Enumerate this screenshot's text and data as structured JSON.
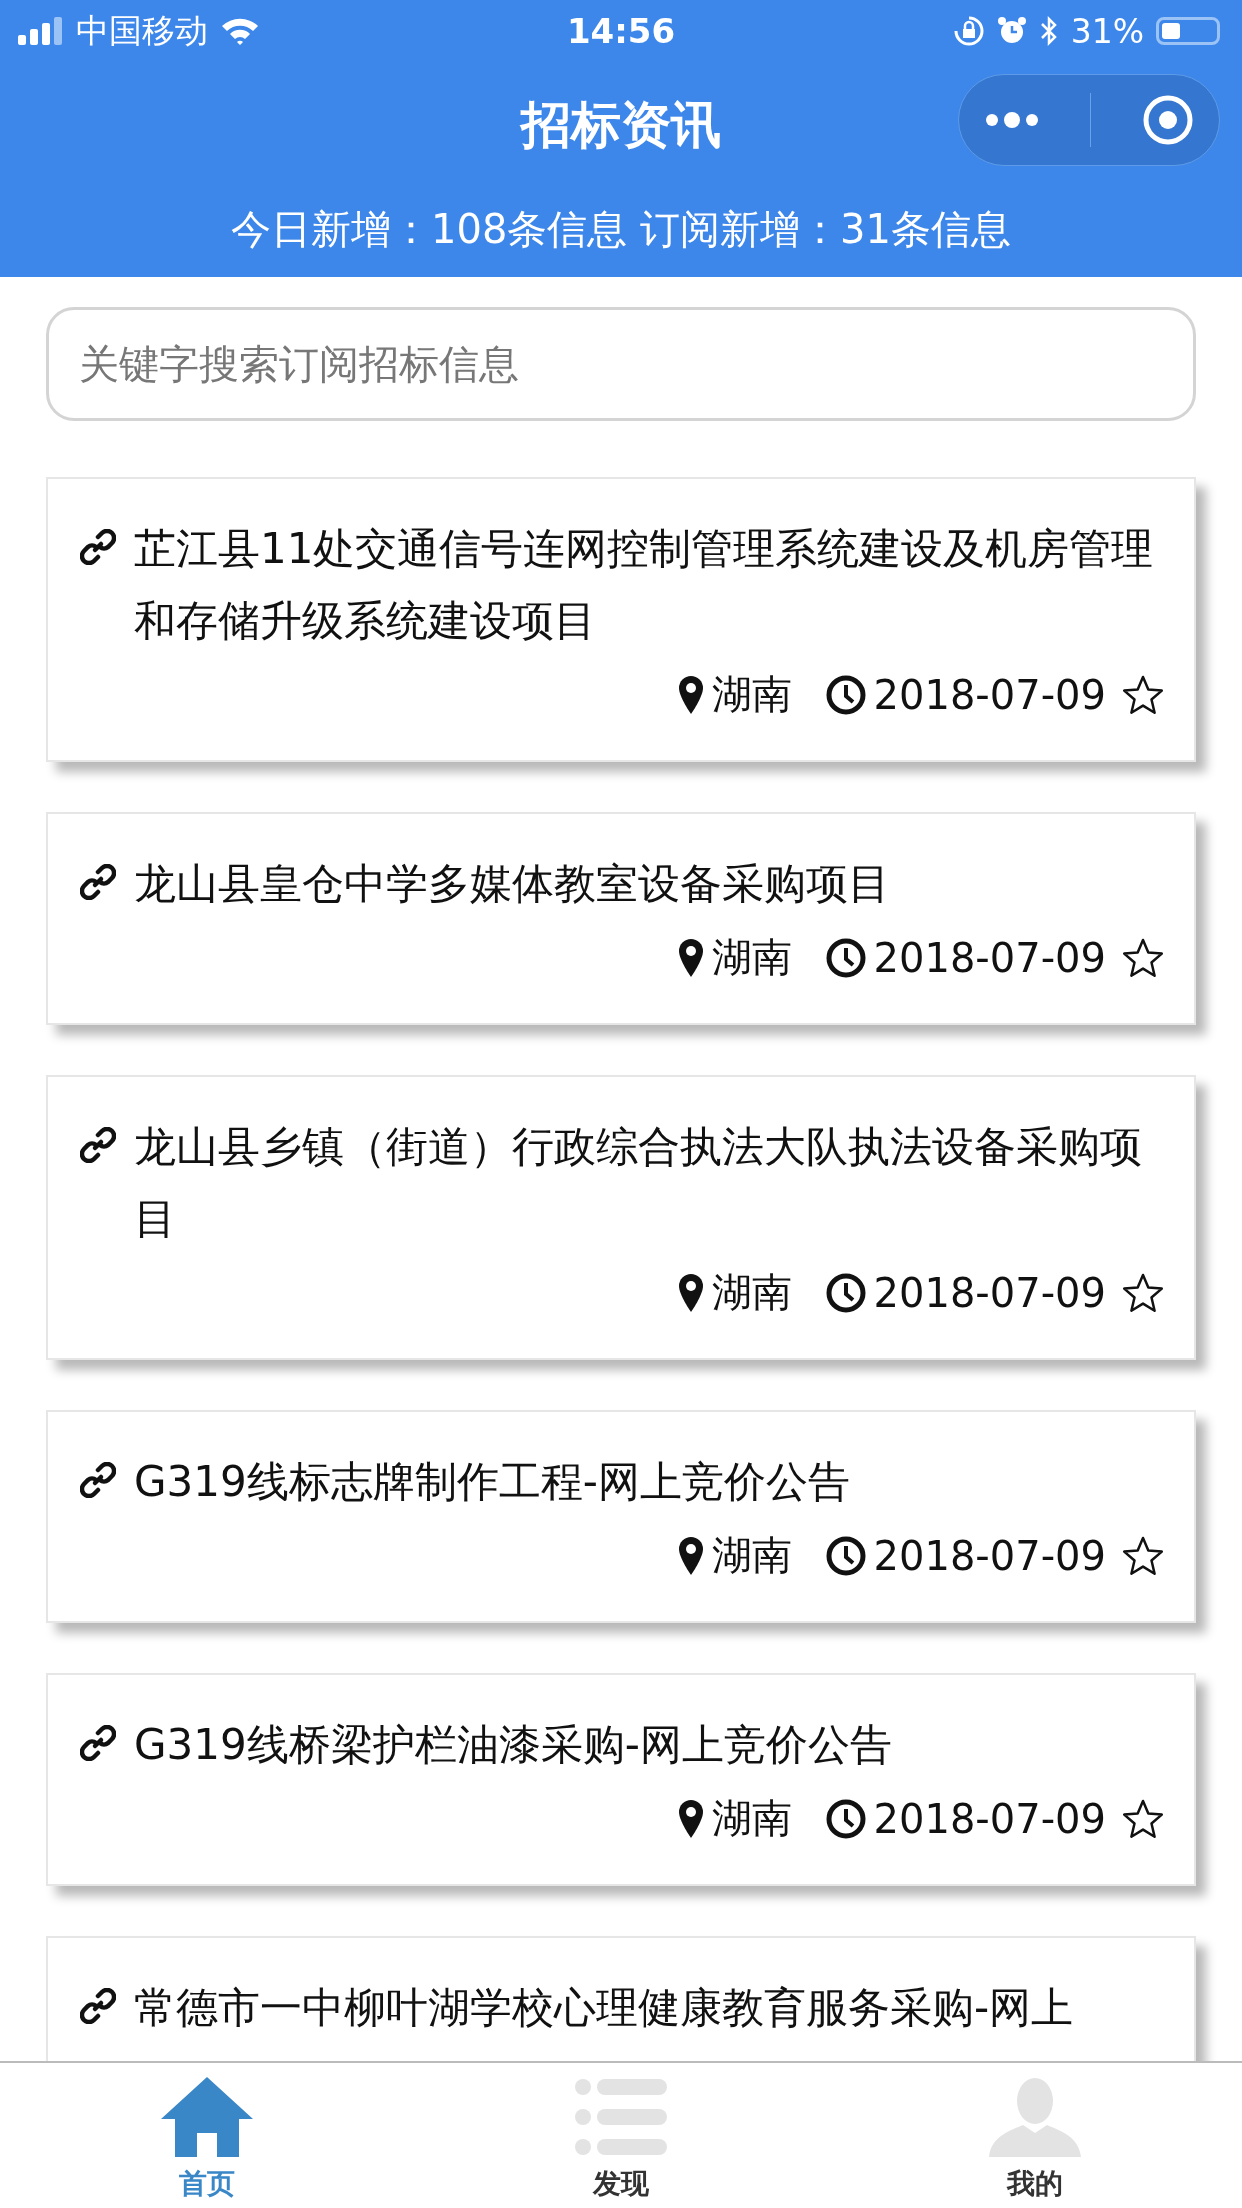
{
  "status_bar": {
    "carrier": "中国移动",
    "time": "14:56",
    "battery": "31%"
  },
  "header": {
    "title": "招标资讯",
    "summary": "今日新增：108条信息 订阅新增：31条信息"
  },
  "search": {
    "placeholder": "关键字搜索订阅招标信息"
  },
  "items": [
    {
      "title": "芷江县11处交通信号连网控制管理系统建设及机房管理和存储升级系统建设项目",
      "region": "湖南",
      "date": "2018-07-09",
      "starred": false
    },
    {
      "title": "龙山县皇仓中学多媒体教室设备采购项目",
      "region": "湖南",
      "date": "2018-07-09",
      "starred": false
    },
    {
      "title": "龙山县乡镇（街道）行政综合执法大队执法设备采购项目",
      "region": "湖南",
      "date": "2018-07-09",
      "starred": false
    },
    {
      "title": "G319线标志牌制作工程-网上竞价公告",
      "region": "湖南",
      "date": "2018-07-09",
      "starred": false
    },
    {
      "title": "G319线桥梁护栏油漆采购-网上竞价公告",
      "region": "湖南",
      "date": "2018-07-09",
      "starred": false
    },
    {
      "title": "常德市一中柳叶湖学校心理健康教育服务采购-网上"
    }
  ],
  "tabs": [
    {
      "kind": "home",
      "label": "首页",
      "selected": true
    },
    {
      "kind": "list",
      "label": "发现",
      "selected": false
    },
    {
      "kind": "person",
      "label": "我的",
      "selected": false
    }
  ]
}
